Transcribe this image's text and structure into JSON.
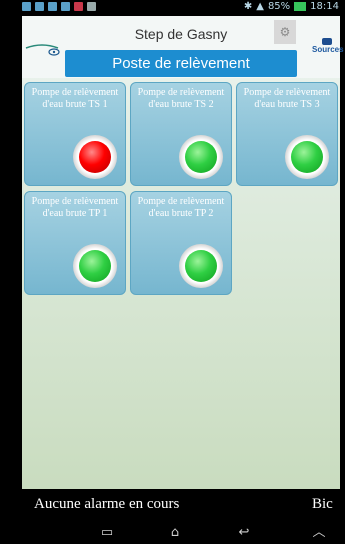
{
  "status_bar": {
    "time": "18:14",
    "battery_pct": "85%",
    "indicator_icons": [
      "notification-icon",
      "notification-icon",
      "notification-icon",
      "notification-icon",
      "mail-icon",
      "image-icon"
    ]
  },
  "header": {
    "title": "Step de Gasny",
    "section": "Poste de relèvement",
    "logo_right_text": "Sources",
    "settings_icon": "settings-icon"
  },
  "pumps": [
    {
      "label": "Pompe de relèvement d'eau brute TS 1",
      "status": "alarm",
      "color": "#ff0000"
    },
    {
      "label": "Pompe de relèvement d'eau brute TS 2",
      "status": "ok",
      "color": "#22c43a"
    },
    {
      "label": "Pompe de relèvement d'eau brute TS 3",
      "status": "ok",
      "color": "#22c43a"
    },
    {
      "label": "Pompe de relèvement d'eau brute TP 1",
      "status": "ok",
      "color": "#22c43a"
    },
    {
      "label": "Pompe de relèvement d'eau brute TP 2",
      "status": "ok",
      "color": "#22c43a"
    }
  ],
  "alarm_bar": {
    "message": "Aucune alarme en cours",
    "trailing": "Bic"
  },
  "navigation": [
    "recent-apps-icon",
    "home-icon",
    "back-icon",
    "menu-up-icon"
  ]
}
